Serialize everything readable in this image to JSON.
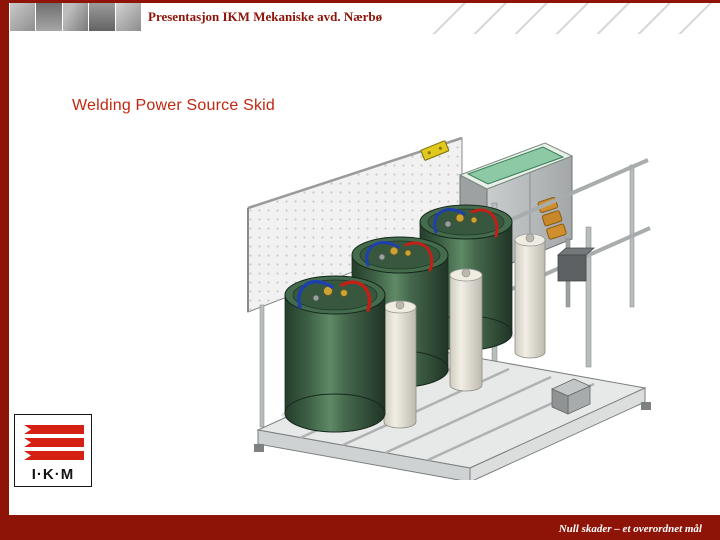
{
  "theme": {
    "accent_red": "#8e1407",
    "heading_red": "#c2270f",
    "footer_bg": "#8e1407",
    "logo_red": "#d42114",
    "tank_green": "#3f6347",
    "glass_green": "#8cc9a4",
    "slide_bg": "#ffffff"
  },
  "header": {
    "title": "Presentasjon IKM Mekaniske avd. Nærbø"
  },
  "slide": {
    "heading": "Welding Power Source Skid"
  },
  "logo": {
    "text": "I·K·M"
  },
  "footer": {
    "text": "Null skader – et overordnet mål"
  }
}
